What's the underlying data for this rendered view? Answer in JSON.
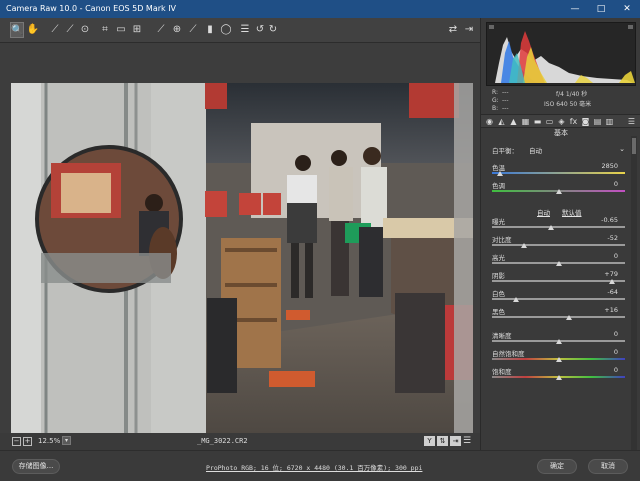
{
  "app": {
    "title": "Camera Raw 10.0 -  Canon EOS 5D Mark IV",
    "window_controls": [
      "—",
      "□",
      "✕"
    ]
  },
  "toolbar": {
    "tools": [
      {
        "name": "zoom-tool-icon",
        "glyph": "🔍"
      },
      {
        "name": "hand-tool-icon",
        "glyph": "✋"
      },
      {
        "name": "white-balance-tool-icon",
        "glyph": "⟋"
      },
      {
        "name": "color-sampler-tool-icon",
        "glyph": "⟋"
      },
      {
        "name": "targeted-adjustment-tool-icon",
        "glyph": "⊙"
      },
      {
        "name": "crop-tool-icon",
        "glyph": "⌗"
      },
      {
        "name": "straighten-tool-icon",
        "glyph": "▭"
      },
      {
        "name": "transform-tool-icon",
        "glyph": "⊞"
      },
      {
        "name": "spot-removal-tool-icon",
        "glyph": "⟋"
      },
      {
        "name": "red-eye-tool-icon",
        "glyph": "⊕"
      },
      {
        "name": "adjustment-brush-icon",
        "glyph": "⟋"
      },
      {
        "name": "graduated-filter-icon",
        "glyph": "▮"
      },
      {
        "name": "radial-filter-icon",
        "glyph": "◯"
      },
      {
        "name": "preferences-icon",
        "glyph": "☰"
      },
      {
        "name": "rotate-left-icon",
        "glyph": "↺"
      },
      {
        "name": "rotate-right-icon",
        "glyph": "↻"
      }
    ],
    "right_tools": [
      {
        "name": "toggle-fullscreen-icon",
        "glyph": "⇄"
      },
      {
        "name": "open-in-photoshop-icon",
        "glyph": "⇥"
      }
    ]
  },
  "histogram_info": {
    "rgb_r": "R:",
    "rgb_g": "G:",
    "rgb_b": "B:",
    "dashes": "---",
    "aperture_shutter": "f/4   1/40 秒",
    "iso_focal": "ISO 640   50 毫米"
  },
  "panel": {
    "section_title": "基本",
    "white_balance_label": "白平衡：",
    "white_balance_value": "自动",
    "auto_link": "自动",
    "default_link": "默认值",
    "sliders": [
      {
        "key": "temperature",
        "label": "色温",
        "value": "2850",
        "pos": 0.06,
        "gradient": "linear-gradient(to right, #3a78d8, #e8d24a)"
      },
      {
        "key": "tint",
        "label": "色调",
        "value": "0",
        "pos": 0.5,
        "gradient": "linear-gradient(to right, #3fbf3f, #c24fc2)"
      },
      {
        "key": "exposure",
        "label": "曝光",
        "value": "-0.65",
        "pos": 0.44,
        "gradient": ""
      },
      {
        "key": "contrast",
        "label": "对比度",
        "value": "-52",
        "pos": 0.24,
        "gradient": ""
      },
      {
        "key": "highlights",
        "label": "高光",
        "value": "0",
        "pos": 0.5,
        "gradient": ""
      },
      {
        "key": "shadows",
        "label": "阴影",
        "value": "+79",
        "pos": 0.9,
        "gradient": ""
      },
      {
        "key": "whites",
        "label": "白色",
        "value": "-64",
        "pos": 0.18,
        "gradient": ""
      },
      {
        "key": "blacks",
        "label": "黑色",
        "value": "+16",
        "pos": 0.58,
        "gradient": ""
      },
      {
        "key": "clarity",
        "label": "清晰度",
        "value": "0",
        "pos": 0.5,
        "gradient": ""
      },
      {
        "key": "vibrance",
        "label": "自然饱和度",
        "value": "0",
        "pos": 0.5,
        "gradient": "linear-gradient(to right, #888, #c04040, #c0c040, #40c040, #4040c0)"
      },
      {
        "key": "saturation",
        "label": "饱和度",
        "value": "0",
        "pos": 0.5,
        "gradient": "linear-gradient(to right, #888, #c04040, #c0c040, #40c040, #4040c0)"
      }
    ]
  },
  "canvas_bar": {
    "zoom_level": "12.5%",
    "filename": "_MG_3022.CR2"
  },
  "bottom": {
    "save_label": "存储图像...",
    "workflow_text": "ProPhoto RGB; 16 位; 6720 x 4480 (30.1 百万像素); 300 ppi",
    "ok_label": "确定",
    "cancel_label": "取消"
  },
  "colors": {
    "titlebar": "#1f4f86",
    "panel_bg": "#3a3a3a"
  }
}
